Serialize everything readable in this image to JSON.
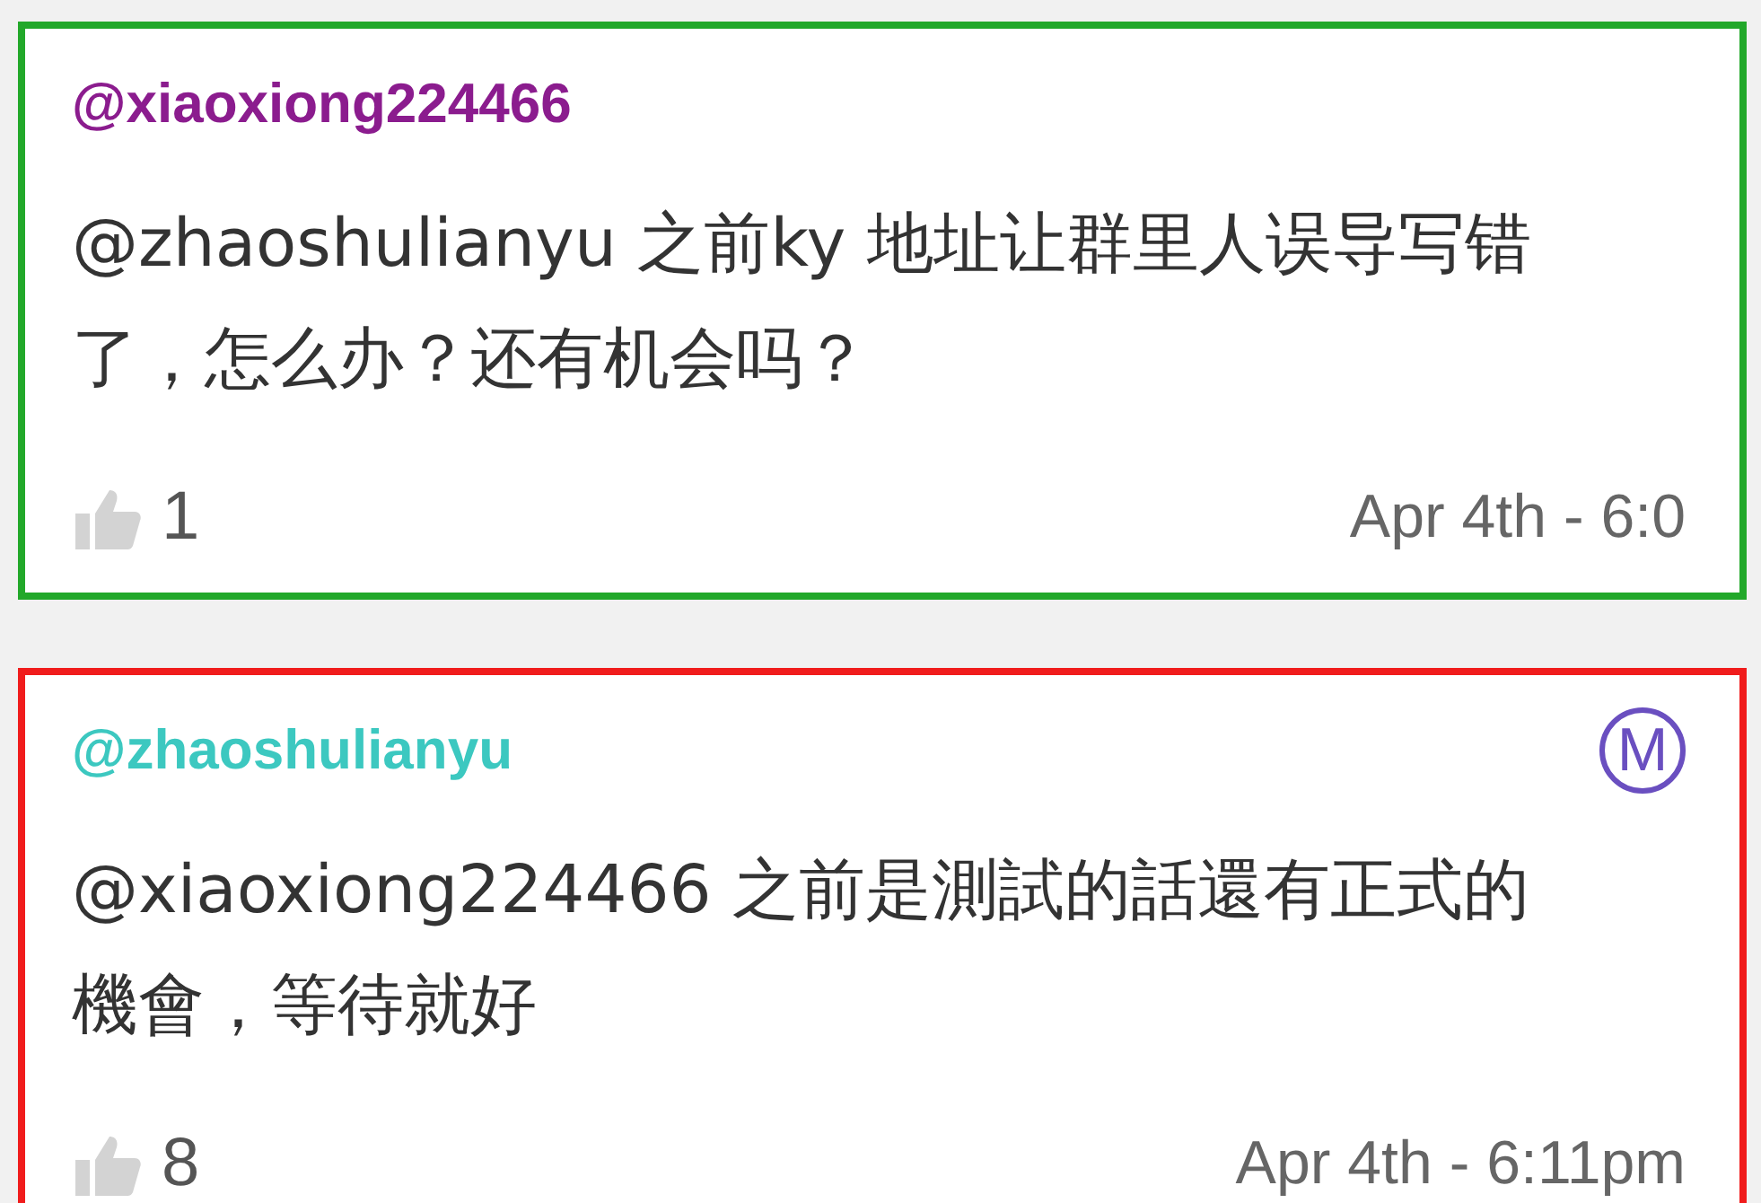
{
  "comments": [
    {
      "kind": "member",
      "username": "@xiaoxiong224466",
      "color": "#22a82a",
      "text": "@zhaoshulianyu 之前ky 地址让群里人误导写错了，怎么办？还有机会吗？",
      "likes": "1",
      "time": "Apr 4th - 6:0"
    },
    {
      "kind": "moderator",
      "username": "@zhaoshulianyu",
      "color": "#f01c1c",
      "badge": "M",
      "text": "@xiaoxiong224466 之前是測試的話還有正式的機會，等待就好",
      "likes": "8",
      "time": "Apr 4th - 6:11pm"
    }
  ]
}
